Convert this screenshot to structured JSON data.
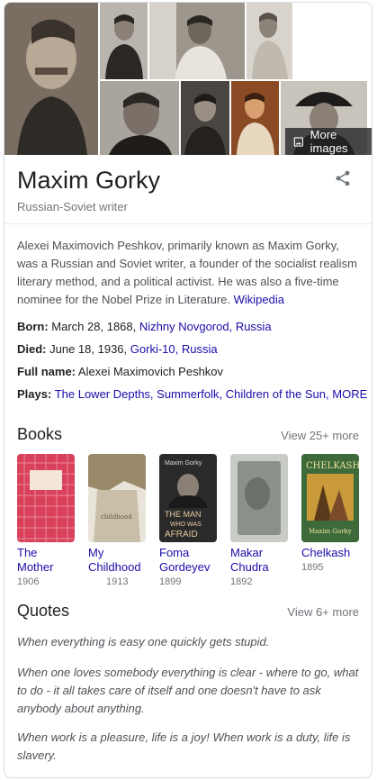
{
  "images": {
    "more_label": "More images",
    "icon": "image-icon"
  },
  "entity": {
    "name": "Maxim Gorky",
    "subtitle": "Russian-Soviet writer",
    "share_icon": "share-icon"
  },
  "description": {
    "text": "Alexei Maximovich Peshkov, primarily known as Maxim Gorky, was a Russian and Soviet writer, a founder of the socialist realism literary method, and a political activist. He was also a five-time nominee for the Nobel Prize in Literature.",
    "source": "Wikipedia"
  },
  "facts": {
    "born_label": "Born:",
    "born_date": "March 28, 1868,",
    "born_place": "Nizhny Novgorod, Russia",
    "died_label": "Died:",
    "died_date": "June 18, 1936,",
    "died_place": "Gorki-10, Russia",
    "fullname_label": "Full name:",
    "fullname_value": "Alexei Maximovich Peshkov",
    "plays_label": "Plays:",
    "plays_value": "The Lower Depths, Summerfolk, Children of the Sun,",
    "plays_more": "MORE"
  },
  "books": {
    "title": "Books",
    "view_more": "View 25+ more",
    "items": [
      {
        "title": "The Mother",
        "year": "1906"
      },
      {
        "title": "My Childhood",
        "year": "1913"
      },
      {
        "title": "Foma Gordeyev",
        "year": "1899"
      },
      {
        "title": "Makar Chudra",
        "year": "1892"
      },
      {
        "title": "Chelkash",
        "year": "1895"
      }
    ],
    "cover_text": {
      "foma_author": "Maxim Gorky",
      "foma_line1": "THE MAN",
      "foma_line2": "WHO WAS",
      "foma_line3": "AFRAID",
      "chelkash_title": "CHELKASH",
      "chelkash_author": "Maxim Gorky",
      "childhood": "childhood"
    }
  },
  "quotes": {
    "title": "Quotes",
    "view_more": "View 6+ more",
    "items": [
      "When everything is easy one quickly gets stupid.",
      "When one loves somebody everything is clear - where to go, what to do - it all takes care of itself and one doesn't have to ask anybody about anything.",
      "When work is a pleasure, life is a joy! When work is a duty, life is slavery."
    ]
  },
  "colors": {
    "link": "#1a0dab",
    "muted": "#70757a",
    "body": "#4d5156",
    "the_mother_cover": "#d9415a",
    "foma_cover": "#2a2a2a",
    "chelkash_cover": "#3d6a3a"
  }
}
